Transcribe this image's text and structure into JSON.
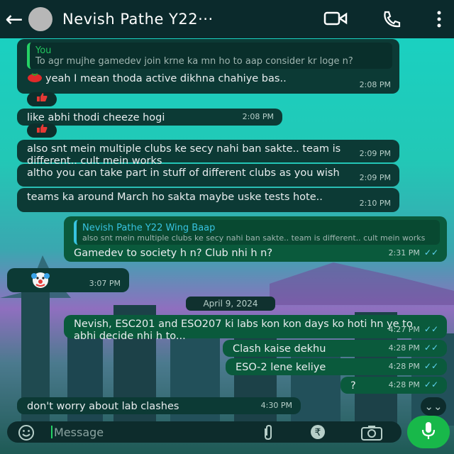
{
  "header": {
    "title": "Nevish Pathe Y22···"
  },
  "messages": [
    {
      "quote_author": "You",
      "quote_text": "To agr mujhe gamedev join krne ka mn ho to aap consider kr loge n?",
      "text": "yeah I mean thoda active dikhna chahiye bas..",
      "time": "2:08 PM"
    },
    {
      "text": "like abhi thodi cheeze hogi",
      "time": "2:08 PM"
    },
    {
      "text": "also snt mein multiple clubs ke secy nahi ban sakte.. team is different.. cult mein works",
      "time": "2:09 PM"
    },
    {
      "text": "altho you can take part in stuff of different clubs as you wish",
      "time": "2:09 PM"
    },
    {
      "text": "teams ka around March ho sakta maybe uske tests hote..",
      "time": "2:10 PM"
    },
    {
      "quote_author": "Nevish Pathe Y22 Wing Baap",
      "quote_text": "also snt mein multiple clubs ke secy nahi ban sakte.. team is different.. cult mein works",
      "text": "Gamedev to society h n? Club nhi h n?",
      "time": "2:31 PM"
    },
    {
      "text": "",
      "time": "3:07 PM"
    },
    {
      "text": "Nevish, ESC201 and ESO207 ki labs  kon kon days ko hoti hn ye to abhi decide nhi h to...",
      "time": "4:27 PM"
    },
    {
      "text": "Clash kaise dekhu",
      "time": "4:28 PM"
    },
    {
      "text": "ESO-2 lene keliye",
      "time": "4:28 PM"
    },
    {
      "text": "?",
      "time": "4:28 PM"
    },
    {
      "text": "don't worry about lab clashes",
      "time": "4:30 PM"
    }
  ],
  "date_divider": "April 9, 2024",
  "composer": {
    "placeholder": "Message"
  },
  "colors": {
    "header_bg": "#0b2a2c",
    "incoming_bubble": "#0c3a35",
    "outgoing_bubble": "#0a5a3c",
    "read_ticks": "#5fd4f2",
    "mic_button": "#18b84a"
  },
  "icons": [
    "back-arrow-icon",
    "video-call-icon",
    "phone-icon",
    "more-options-icon",
    "thumbs-up-reaction",
    "emoji-icon",
    "attach-icon",
    "rupee-icon",
    "camera-icon",
    "mic-icon",
    "scroll-down-icon"
  ]
}
